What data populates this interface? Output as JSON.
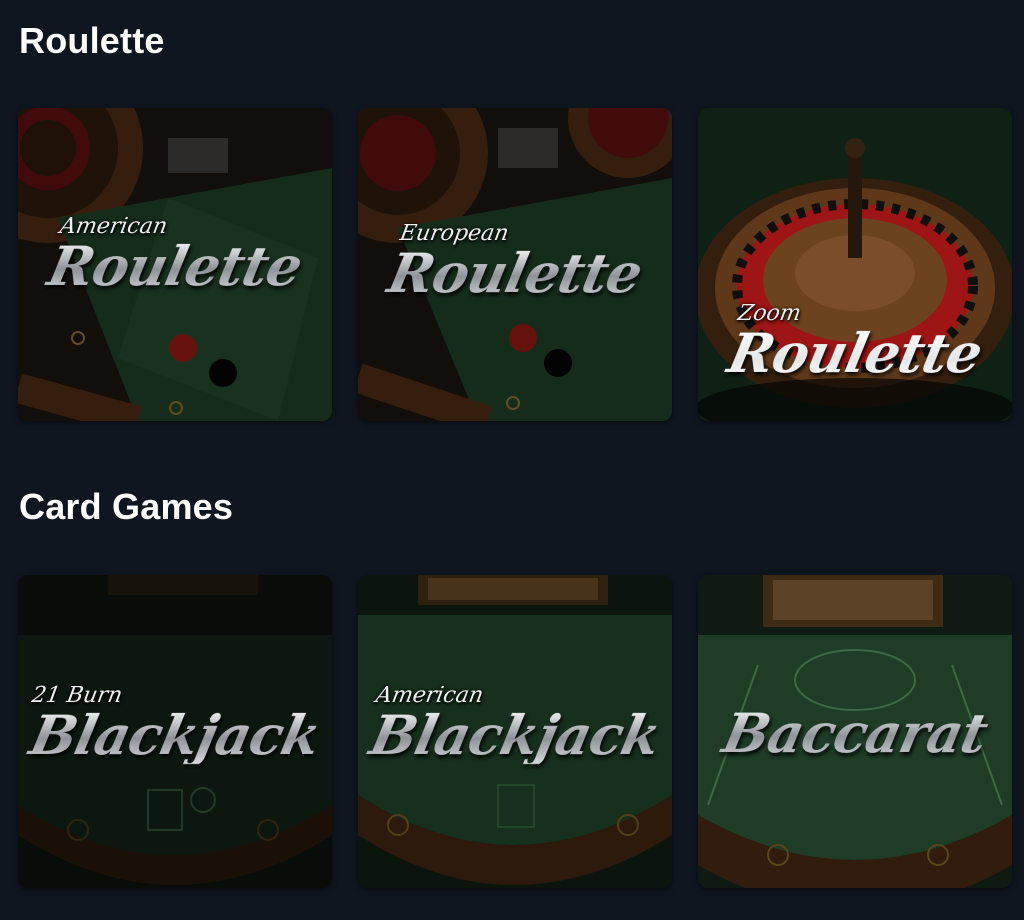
{
  "sections": [
    {
      "title": "Roulette",
      "games": [
        {
          "sub": "American",
          "main": "Roulette"
        },
        {
          "sub": "European",
          "main": "Roulette"
        },
        {
          "sub": "Zoom",
          "main": "Roulette"
        }
      ]
    },
    {
      "title": "Card Games",
      "games": [
        {
          "sub": "21 Burn",
          "main": "Blackjack"
        },
        {
          "sub": "American",
          "main": "Blackjack"
        },
        {
          "sub": "",
          "main": "Baccarat"
        }
      ]
    }
  ],
  "colors": {
    "background": "#0f1620",
    "felt_green": "#1f4a2c",
    "wood": "#4a2a14",
    "title": "#ffffff"
  }
}
